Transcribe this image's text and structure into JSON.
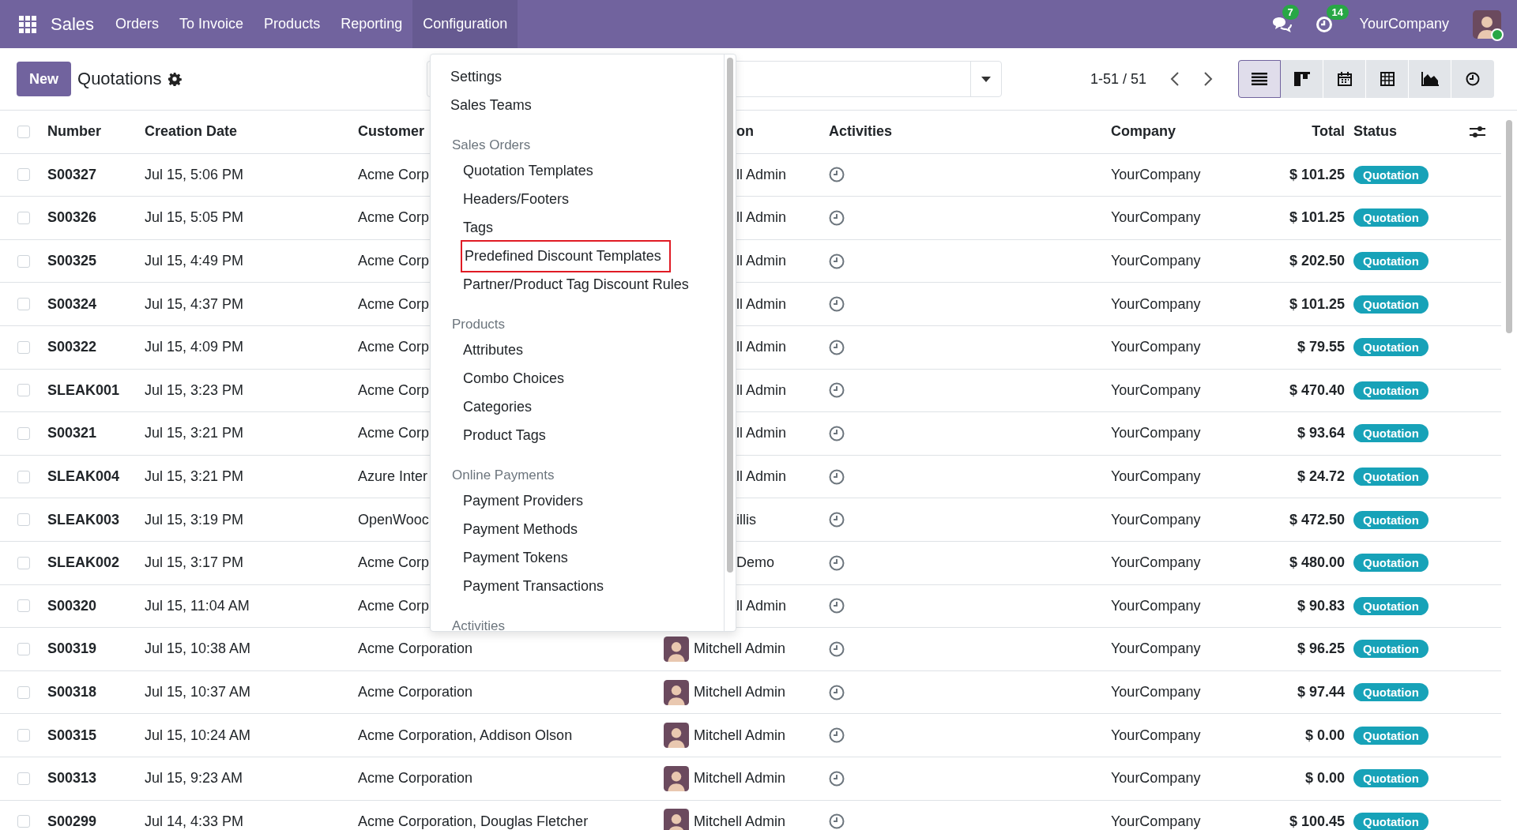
{
  "navbar": {
    "brand": "Sales",
    "menu": [
      {
        "label": "Orders",
        "selected": false
      },
      {
        "label": "To Invoice",
        "selected": false
      },
      {
        "label": "Products",
        "selected": false
      },
      {
        "label": "Reporting",
        "selected": false
      },
      {
        "label": "Configuration",
        "selected": true
      }
    ],
    "messages_badge": "7",
    "activities_badge": "14",
    "company": "YourCompany"
  },
  "control_panel": {
    "new_button": "New",
    "title": "Quotations",
    "pager": "1-51 / 51",
    "views": [
      {
        "kind": "list",
        "selected": true
      },
      {
        "kind": "kanban",
        "selected": false
      },
      {
        "kind": "calendar",
        "selected": false
      },
      {
        "kind": "pivot",
        "selected": false
      },
      {
        "kind": "graph",
        "selected": false
      },
      {
        "kind": "activity",
        "selected": false
      }
    ]
  },
  "table": {
    "header_checked": false,
    "columns": [
      "Number",
      "Creation Date",
      "Customer",
      "on",
      "Activities",
      "Company",
      "Total",
      "Status"
    ],
    "rows": [
      {
        "checked": false,
        "number": "S00327",
        "date": "Jul 15, 5:06 PM",
        "customer": "Acme Corp",
        "salesperson": "ll Admin",
        "avatar": false,
        "company": "YourCompany",
        "total": "$ 101.25",
        "status": "Quotation"
      },
      {
        "checked": false,
        "number": "S00326",
        "date": "Jul 15, 5:05 PM",
        "customer": "Acme Corp",
        "salesperson": "ll Admin",
        "avatar": false,
        "company": "YourCompany",
        "total": "$ 101.25",
        "status": "Quotation"
      },
      {
        "checked": false,
        "number": "S00325",
        "date": "Jul 15, 4:49 PM",
        "customer": "Acme Corp",
        "salesperson": "ll Admin",
        "avatar": false,
        "company": "YourCompany",
        "total": "$ 202.50",
        "status": "Quotation"
      },
      {
        "checked": false,
        "number": "S00324",
        "date": "Jul 15, 4:37 PM",
        "customer": "Acme Corp",
        "salesperson": "ll Admin",
        "avatar": false,
        "company": "YourCompany",
        "total": "$ 101.25",
        "status": "Quotation"
      },
      {
        "checked": false,
        "number": "S00322",
        "date": "Jul 15, 4:09 PM",
        "customer": "Acme Corp",
        "salesperson": "ll Admin",
        "avatar": false,
        "company": "YourCompany",
        "total": "$ 79.55",
        "status": "Quotation"
      },
      {
        "checked": false,
        "number": "SLEAK001",
        "date": "Jul 15, 3:23 PM",
        "customer": "Acme Corp",
        "salesperson": "ll Admin",
        "avatar": false,
        "company": "YourCompany",
        "total": "$ 470.40",
        "status": "Quotation"
      },
      {
        "checked": false,
        "number": "S00321",
        "date": "Jul 15, 3:21 PM",
        "customer": "Acme Corp",
        "salesperson": "ll Admin",
        "avatar": false,
        "company": "YourCompany",
        "total": "$ 93.64",
        "status": "Quotation"
      },
      {
        "checked": false,
        "number": "SLEAK004",
        "date": "Jul 15, 3:21 PM",
        "customer": "Azure Inter",
        "salesperson": "ll Admin",
        "avatar": false,
        "company": "YourCompany",
        "total": "$ 24.72",
        "status": "Quotation"
      },
      {
        "checked": false,
        "number": "SLEAK003",
        "date": "Jul 15, 3:19 PM",
        "customer": "OpenWooc",
        "salesperson": "illis",
        "avatar": false,
        "company": "YourCompany",
        "total": "$ 472.50",
        "status": "Quotation"
      },
      {
        "checked": false,
        "number": "SLEAK002",
        "date": "Jul 15, 3:17 PM",
        "customer": "Acme Corp",
        "salesperson": "Demo",
        "avatar": false,
        "company": "YourCompany",
        "total": "$ 480.00",
        "status": "Quotation"
      },
      {
        "checked": false,
        "number": "S00320",
        "date": "Jul 15, 11:04 AM",
        "customer": "Acme Corp",
        "salesperson": "ll Admin",
        "avatar": false,
        "company": "YourCompany",
        "total": "$ 90.83",
        "status": "Quotation"
      },
      {
        "checked": false,
        "number": "S00319",
        "date": "Jul 15, 10:38 AM",
        "customer": "Acme Corporation",
        "salesperson": "Mitchell Admin",
        "avatar": true,
        "company": "YourCompany",
        "total": "$ 96.25",
        "status": "Quotation"
      },
      {
        "checked": false,
        "number": "S00318",
        "date": "Jul 15, 10:37 AM",
        "customer": "Acme Corporation",
        "salesperson": "Mitchell Admin",
        "avatar": true,
        "company": "YourCompany",
        "total": "$ 97.44",
        "status": "Quotation"
      },
      {
        "checked": false,
        "number": "S00315",
        "date": "Jul 15, 10:24 AM",
        "customer": "Acme Corporation, Addison Olson",
        "salesperson": "Mitchell Admin",
        "avatar": true,
        "company": "YourCompany",
        "total": "$ 0.00",
        "status": "Quotation"
      },
      {
        "checked": false,
        "number": "S00313",
        "date": "Jul 15, 9:23 AM",
        "customer": "Acme Corporation",
        "salesperson": "Mitchell Admin",
        "avatar": true,
        "company": "YourCompany",
        "total": "$ 0.00",
        "status": "Quotation"
      },
      {
        "checked": false,
        "number": "S00299",
        "date": "Jul 14, 4:33 PM",
        "customer": "Acme Corporation, Douglas Fletcher",
        "salesperson": "Mitchell Admin",
        "avatar": true,
        "company": "YourCompany",
        "total": "$ 100.45",
        "status": "Quotation"
      }
    ]
  },
  "dropdown": {
    "items": [
      {
        "kind": "item",
        "label": "Settings",
        "highlighted": false
      },
      {
        "kind": "item",
        "label": "Sales Teams",
        "highlighted": false
      },
      {
        "kind": "section",
        "label": "Sales Orders",
        "highlighted": false
      },
      {
        "kind": "subitem",
        "label": "Quotation Templates",
        "highlighted": false
      },
      {
        "kind": "subitem",
        "label": "Headers/Footers",
        "highlighted": false
      },
      {
        "kind": "subitem",
        "label": "Tags",
        "highlighted": false
      },
      {
        "kind": "subitem",
        "label": "Predefined Discount Templates",
        "highlighted": true
      },
      {
        "kind": "subitem",
        "label": "Partner/Product Tag Discount Rules",
        "highlighted": false
      },
      {
        "kind": "section",
        "label": "Products",
        "highlighted": false
      },
      {
        "kind": "subitem",
        "label": "Attributes",
        "highlighted": false
      },
      {
        "kind": "subitem",
        "label": "Combo Choices",
        "highlighted": false
      },
      {
        "kind": "subitem",
        "label": "Categories",
        "highlighted": false
      },
      {
        "kind": "subitem",
        "label": "Product Tags",
        "highlighted": false
      },
      {
        "kind": "section",
        "label": "Online Payments",
        "highlighted": false
      },
      {
        "kind": "subitem",
        "label": "Payment Providers",
        "highlighted": false
      },
      {
        "kind": "subitem",
        "label": "Payment Methods",
        "highlighted": false
      },
      {
        "kind": "subitem",
        "label": "Payment Tokens",
        "highlighted": false
      },
      {
        "kind": "subitem",
        "label": "Payment Transactions",
        "highlighted": false
      },
      {
        "kind": "section",
        "label": "Activities",
        "highlighted": false
      }
    ]
  }
}
